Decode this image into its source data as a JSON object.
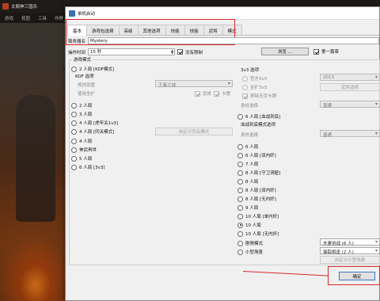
{
  "background": {
    "title": "太阁神三国杀",
    "menu": [
      "游戏",
      "视图",
      "工具",
      "作弊"
    ]
  },
  "dialog": {
    "title": "单机启动",
    "tabs": [
      "基本",
      "游戏包选择",
      "高级",
      "其他选项",
      "技能",
      "技能",
      "武将",
      "模式"
    ],
    "server_name_label": "服务器名",
    "server_name_value": "Mystery",
    "op_time_label": "操作时间",
    "op_time_value": "15 秒",
    "no_limit_label": "没有限制",
    "no_limit_checked": true,
    "browse_label": "浏览 ...",
    "first_chapter_label": "第一篇章",
    "first_chapter_checked": true,
    "game_mode_label": "游戏模式",
    "left_options": [
      {
        "label": "2 人局 [KOF模式]",
        "checked": false
      },
      {
        "label": "2 人局",
        "checked": false
      },
      {
        "label": "3 人局",
        "checked": false
      },
      {
        "label": "4 人局 [虎牢关1v3]",
        "checked": false
      },
      {
        "label": "4 人局 [同关模式]",
        "checked": false
      },
      {
        "label": "4 人局",
        "checked": false
      },
      {
        "label": "神武再世",
        "checked": false
      },
      {
        "label": "5 人局",
        "checked": false
      },
      {
        "label": "6 人局 [3v3]",
        "checked": false
      }
    ],
    "kof": {
      "title": "KOF 选项",
      "rule_label": "规则设置",
      "rule_value": "王者之战",
      "use_expand_label": "使用全扩",
      "generals_label": "武将",
      "cards_label": "卡牌"
    },
    "custom_3v3_btn": "自定义同关模式",
    "v3": {
      "title": "3v3 选项",
      "official_label": "官方3v3",
      "official_value": "2013",
      "expand_label": "全扩3v3",
      "choose_generals_btn": "武将选择",
      "exclude_label": "移除无尽卡牌",
      "role_label": "身份选择",
      "role_value": "普通"
    },
    "six_one_label": "6 人局 [血战到底]",
    "blood_title": "血战到底模式选项",
    "blood_role_label": "身份选择",
    "blood_role_value": "普通",
    "right_options": [
      {
        "label": "6 人局",
        "checked": false
      },
      {
        "label": "6 人局 [双内奸]",
        "checked": false
      },
      {
        "label": "7 人局",
        "checked": false
      },
      {
        "label": "8 人局 [守卫洞窟]",
        "checked": false
      },
      {
        "label": "8 人局",
        "checked": false
      },
      {
        "label": "8 人局 [双内奸]",
        "checked": false
      },
      {
        "label": "8 人局 [无内奸]",
        "checked": false
      },
      {
        "label": "9 人局",
        "checked": false
      },
      {
        "label": "10 人局 [单内奸]",
        "checked": false
      },
      {
        "label": "10 人局",
        "checked": true
      },
      {
        "label": "10 人局 [无内奸]",
        "checked": false
      }
    ],
    "scenario_label": "剧情模式",
    "scenario_value": "夫妻协战 (6 人)",
    "mini_label": "小型场景",
    "mini_value": "锋踪相逢 (2 人)",
    "custom_mini_btn": "自定义小型场景",
    "confirm_label": "确定",
    "accent_red": "#d8282a"
  }
}
